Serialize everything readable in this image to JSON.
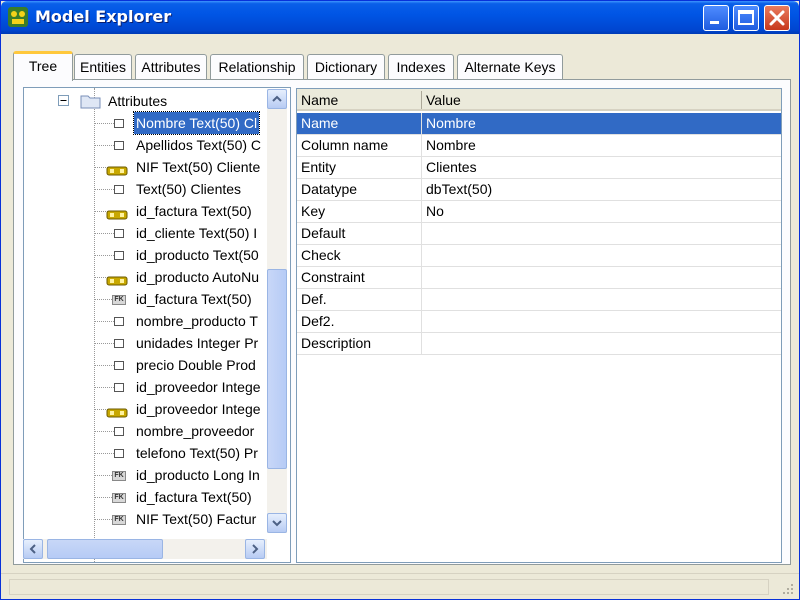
{
  "window": {
    "title": "Model Explorer"
  },
  "tabs": [
    "Tree",
    "Entities",
    "Attributes",
    "Relationship",
    "Dictionary",
    "Indexes",
    "Alternate Keys"
  ],
  "active_tab": "Tree",
  "tree": {
    "root_label": "Attributes",
    "items": [
      {
        "label": "Nombre Text(50)  Cl",
        "icon": "attribute-icon",
        "selected": true
      },
      {
        "label": "Apellidos Text(50)  C",
        "icon": "attribute-icon"
      },
      {
        "label": "NIF Text(50)  Cliente",
        "icon": "primary-key-icon"
      },
      {
        "label": " Text(50)  Clientes",
        "icon": "attribute-icon"
      },
      {
        "label": "id_factura Text(50)",
        "icon": "primary-key-icon"
      },
      {
        "label": "id_cliente Text(50)  I",
        "icon": "attribute-icon"
      },
      {
        "label": "id_producto Text(50",
        "icon": "attribute-icon"
      },
      {
        "label": "id_producto AutoNu",
        "icon": "primary-key-icon"
      },
      {
        "label": "id_factura Text(50)",
        "icon": "foreign-key-icon"
      },
      {
        "label": "nombre_producto T",
        "icon": "attribute-icon"
      },
      {
        "label": "unidades Integer  Pr",
        "icon": "attribute-icon"
      },
      {
        "label": "precio Double  Prod",
        "icon": "attribute-icon"
      },
      {
        "label": "id_proveedor Intege",
        "icon": "attribute-icon"
      },
      {
        "label": "id_proveedor Intege",
        "icon": "primary-key-icon"
      },
      {
        "label": "nombre_proveedor",
        "icon": "attribute-icon"
      },
      {
        "label": "telefono Text(50)  Pr",
        "icon": "attribute-icon"
      },
      {
        "label": "id_producto Long In",
        "icon": "foreign-key-icon"
      },
      {
        "label": "id_factura Text(50)",
        "icon": "foreign-key-icon"
      },
      {
        "label": "NIF Text(50)  Factur",
        "icon": "foreign-key-icon"
      }
    ]
  },
  "properties": {
    "headers": {
      "name": "Name",
      "value": "Value"
    },
    "rows": [
      {
        "name": "Name",
        "value": "Nombre",
        "selected": true
      },
      {
        "name": "Column name",
        "value": "Nombre"
      },
      {
        "name": "Entity",
        "value": "Clientes"
      },
      {
        "name": "Datatype",
        "value": "dbText(50)"
      },
      {
        "name": "Key",
        "value": "No"
      },
      {
        "name": "Default",
        "value": ""
      },
      {
        "name": "Check",
        "value": ""
      },
      {
        "name": "Constraint",
        "value": ""
      },
      {
        "name": "Def.",
        "value": ""
      },
      {
        "name": "Def2.",
        "value": ""
      },
      {
        "name": "Description",
        "value": ""
      }
    ]
  },
  "colors": {
    "titlebar": "#0055e5",
    "selection": "#316ac5",
    "active_tab_accent": "#ffc83c",
    "key_icon": "#c8a800"
  },
  "icons": {
    "app": "model-explorer-icon",
    "minimize": "minimize-icon",
    "maximize": "maximize-icon",
    "close": "close-icon"
  }
}
